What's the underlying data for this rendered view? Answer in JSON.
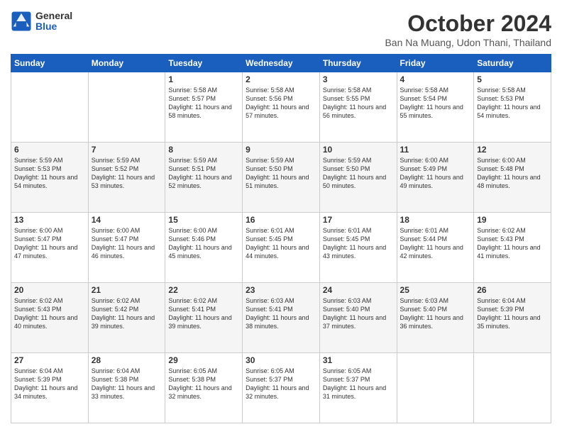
{
  "header": {
    "logo_general": "General",
    "logo_blue": "Blue",
    "month_title": "October 2024",
    "location": "Ban Na Muang, Udon Thani, Thailand"
  },
  "weekdays": [
    "Sunday",
    "Monday",
    "Tuesday",
    "Wednesday",
    "Thursday",
    "Friday",
    "Saturday"
  ],
  "weeks": [
    [
      {
        "day": "",
        "info": ""
      },
      {
        "day": "",
        "info": ""
      },
      {
        "day": "1",
        "info": "Sunrise: 5:58 AM\nSunset: 5:57 PM\nDaylight: 11 hours and 58 minutes."
      },
      {
        "day": "2",
        "info": "Sunrise: 5:58 AM\nSunset: 5:56 PM\nDaylight: 11 hours and 57 minutes."
      },
      {
        "day": "3",
        "info": "Sunrise: 5:58 AM\nSunset: 5:55 PM\nDaylight: 11 hours and 56 minutes."
      },
      {
        "day": "4",
        "info": "Sunrise: 5:58 AM\nSunset: 5:54 PM\nDaylight: 11 hours and 55 minutes."
      },
      {
        "day": "5",
        "info": "Sunrise: 5:58 AM\nSunset: 5:53 PM\nDaylight: 11 hours and 54 minutes."
      }
    ],
    [
      {
        "day": "6",
        "info": "Sunrise: 5:59 AM\nSunset: 5:53 PM\nDaylight: 11 hours and 54 minutes."
      },
      {
        "day": "7",
        "info": "Sunrise: 5:59 AM\nSunset: 5:52 PM\nDaylight: 11 hours and 53 minutes."
      },
      {
        "day": "8",
        "info": "Sunrise: 5:59 AM\nSunset: 5:51 PM\nDaylight: 11 hours and 52 minutes."
      },
      {
        "day": "9",
        "info": "Sunrise: 5:59 AM\nSunset: 5:50 PM\nDaylight: 11 hours and 51 minutes."
      },
      {
        "day": "10",
        "info": "Sunrise: 5:59 AM\nSunset: 5:50 PM\nDaylight: 11 hours and 50 minutes."
      },
      {
        "day": "11",
        "info": "Sunrise: 6:00 AM\nSunset: 5:49 PM\nDaylight: 11 hours and 49 minutes."
      },
      {
        "day": "12",
        "info": "Sunrise: 6:00 AM\nSunset: 5:48 PM\nDaylight: 11 hours and 48 minutes."
      }
    ],
    [
      {
        "day": "13",
        "info": "Sunrise: 6:00 AM\nSunset: 5:47 PM\nDaylight: 11 hours and 47 minutes."
      },
      {
        "day": "14",
        "info": "Sunrise: 6:00 AM\nSunset: 5:47 PM\nDaylight: 11 hours and 46 minutes."
      },
      {
        "day": "15",
        "info": "Sunrise: 6:00 AM\nSunset: 5:46 PM\nDaylight: 11 hours and 45 minutes."
      },
      {
        "day": "16",
        "info": "Sunrise: 6:01 AM\nSunset: 5:45 PM\nDaylight: 11 hours and 44 minutes."
      },
      {
        "day": "17",
        "info": "Sunrise: 6:01 AM\nSunset: 5:45 PM\nDaylight: 11 hours and 43 minutes."
      },
      {
        "day": "18",
        "info": "Sunrise: 6:01 AM\nSunset: 5:44 PM\nDaylight: 11 hours and 42 minutes."
      },
      {
        "day": "19",
        "info": "Sunrise: 6:02 AM\nSunset: 5:43 PM\nDaylight: 11 hours and 41 minutes."
      }
    ],
    [
      {
        "day": "20",
        "info": "Sunrise: 6:02 AM\nSunset: 5:43 PM\nDaylight: 11 hours and 40 minutes."
      },
      {
        "day": "21",
        "info": "Sunrise: 6:02 AM\nSunset: 5:42 PM\nDaylight: 11 hours and 39 minutes."
      },
      {
        "day": "22",
        "info": "Sunrise: 6:02 AM\nSunset: 5:41 PM\nDaylight: 11 hours and 39 minutes."
      },
      {
        "day": "23",
        "info": "Sunrise: 6:03 AM\nSunset: 5:41 PM\nDaylight: 11 hours and 38 minutes."
      },
      {
        "day": "24",
        "info": "Sunrise: 6:03 AM\nSunset: 5:40 PM\nDaylight: 11 hours and 37 minutes."
      },
      {
        "day": "25",
        "info": "Sunrise: 6:03 AM\nSunset: 5:40 PM\nDaylight: 11 hours and 36 minutes."
      },
      {
        "day": "26",
        "info": "Sunrise: 6:04 AM\nSunset: 5:39 PM\nDaylight: 11 hours and 35 minutes."
      }
    ],
    [
      {
        "day": "27",
        "info": "Sunrise: 6:04 AM\nSunset: 5:39 PM\nDaylight: 11 hours and 34 minutes."
      },
      {
        "day": "28",
        "info": "Sunrise: 6:04 AM\nSunset: 5:38 PM\nDaylight: 11 hours and 33 minutes."
      },
      {
        "day": "29",
        "info": "Sunrise: 6:05 AM\nSunset: 5:38 PM\nDaylight: 11 hours and 32 minutes."
      },
      {
        "day": "30",
        "info": "Sunrise: 6:05 AM\nSunset: 5:37 PM\nDaylight: 11 hours and 32 minutes."
      },
      {
        "day": "31",
        "info": "Sunrise: 6:05 AM\nSunset: 5:37 PM\nDaylight: 11 hours and 31 minutes."
      },
      {
        "day": "",
        "info": ""
      },
      {
        "day": "",
        "info": ""
      }
    ]
  ]
}
